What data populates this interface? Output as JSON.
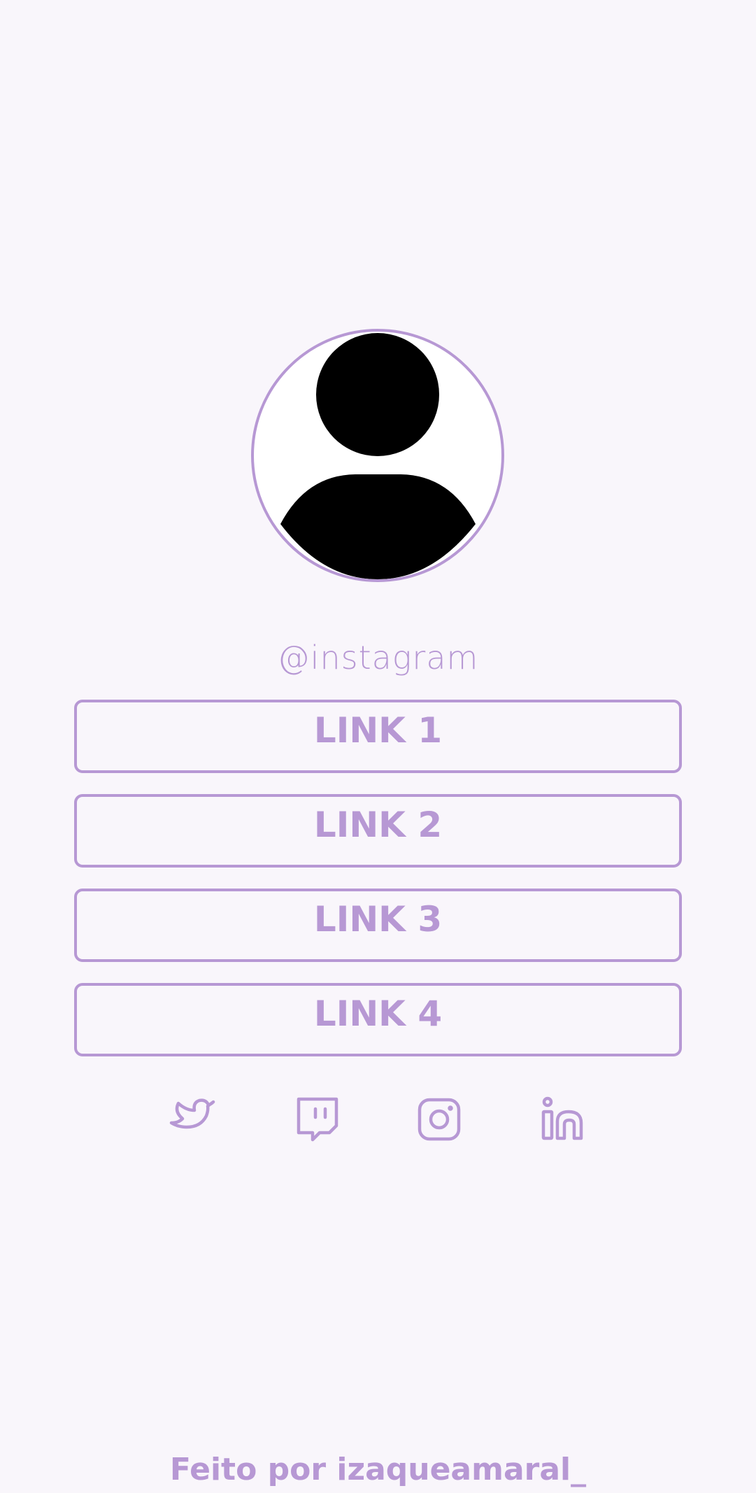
{
  "profile": {
    "avatar_icon": "user-avatar-icon",
    "handle": "@instagram"
  },
  "links": [
    {
      "label": "LINK 1"
    },
    {
      "label": "LINK 2"
    },
    {
      "label": "LINK 3"
    },
    {
      "label": "LINK 4"
    }
  ],
  "socials": [
    {
      "icon": "twitter-icon"
    },
    {
      "icon": "twitch-icon"
    },
    {
      "icon": "instagram-icon"
    },
    {
      "icon": "linkedin-icon"
    }
  ],
  "footer": {
    "text": "Feito por izaqueamaral_"
  },
  "colors": {
    "accent": "#b798d4",
    "background": "#f9f6fb"
  }
}
